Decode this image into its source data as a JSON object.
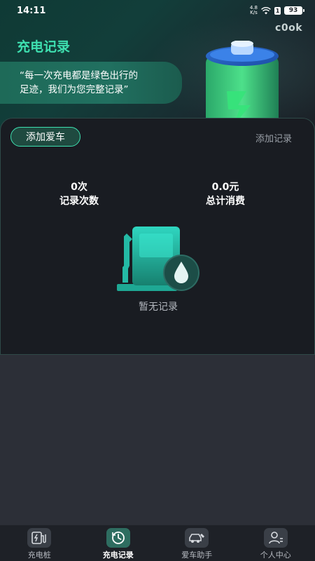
{
  "status_bar": {
    "time": "14:11",
    "net_speed_value": "4.8",
    "net_speed_unit": "K/s",
    "sim": "1",
    "battery": "93"
  },
  "header": {
    "brand": "c0ok",
    "title": "充电记录",
    "quote_line1": "“每一次充电都是绿色出行的",
    "quote_line2": "足迹，我们为您完整记录”"
  },
  "card": {
    "add_car_label": "添加爱车",
    "add_record_label": "添加记录",
    "stats": {
      "count_value": "0次",
      "count_label": "记录次数",
      "spend_value": "0.0元",
      "spend_label": "总计消费"
    },
    "empty_text": "暂无记录"
  },
  "tabs": [
    {
      "label": "充电桩",
      "icon": "charging-pile-icon",
      "active": false
    },
    {
      "label": "充电记录",
      "icon": "history-icon",
      "active": true
    },
    {
      "label": "爱车助手",
      "icon": "car-wrench-icon",
      "active": false
    },
    {
      "label": "个人中心",
      "icon": "user-icon",
      "active": false
    }
  ],
  "colors": {
    "accent": "#3ee0b0",
    "card_bg": "#191c22",
    "page_bg": "#2c2f37",
    "quote_bg": "#1e6a58"
  }
}
